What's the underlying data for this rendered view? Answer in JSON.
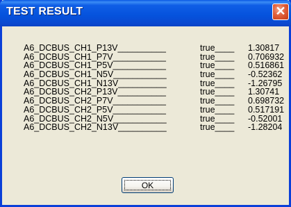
{
  "window": {
    "title": "TEST RESULT",
    "close_glyph": "✕",
    "close_icon": "close-icon"
  },
  "results": [
    {
      "name": "A6_DCBUS_CH1_P13V__________",
      "status": "true____",
      "value": "1.30817"
    },
    {
      "name": "A6_DCBUS_CH1_P7V___________",
      "status": "true____",
      "value": "0.706932"
    },
    {
      "name": "A6_DCBUS_CH1_P5V___________",
      "status": "true____",
      "value": "0.516861"
    },
    {
      "name": "A6_DCBUS_CH1_N5V___________",
      "status": "true____",
      "value": "-0.52362"
    },
    {
      "name": "A6_DCBUS_CH1_N13V__________",
      "status": "true____",
      "value": "-1.26795"
    },
    {
      "name": "A6_DCBUS_CH2_P13V__________",
      "status": "true____",
      "value": "1.30741"
    },
    {
      "name": "A6_DCBUS_CH2_P7V___________",
      "status": "true____",
      "value": "0.698732"
    },
    {
      "name": "A6_DCBUS_CH2_P5V___________",
      "status": "true____",
      "value": "0.517191"
    },
    {
      "name": "A6_DCBUS_CH2_N5V___________",
      "status": "true____",
      "value": "-0.52001"
    },
    {
      "name": "A6_DCBUS_CH2_N13V__________",
      "status": "true____",
      "value": "-1.28204"
    }
  ],
  "buttons": {
    "ok_label": "OK"
  },
  "colors": {
    "titlebar": "#0552dc",
    "window_bg": "#ece9d8",
    "close_button": "#e0603c"
  }
}
